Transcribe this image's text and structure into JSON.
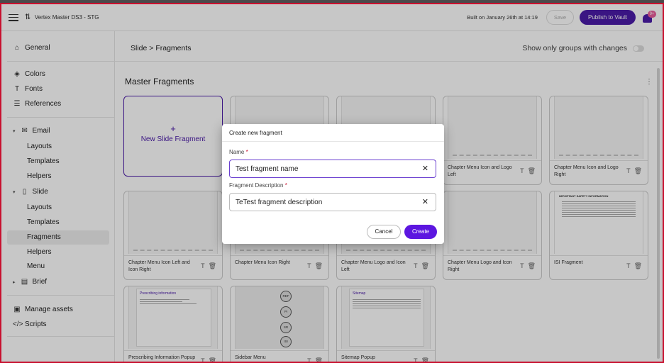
{
  "topbar": {
    "app_title": "Vertex Master DS3 - STG",
    "built_text": "Built on January 26th at 14:19",
    "save_label": "Save",
    "publish_label": "Publish to Vault",
    "notification_badge": "9+"
  },
  "sidebar": {
    "general": "General",
    "colors": "Colors",
    "fonts": "Fonts",
    "references": "References",
    "email": "Email",
    "email_items": [
      "Layouts",
      "Templates",
      "Helpers"
    ],
    "slide": "Slide",
    "slide_items": [
      "Layouts",
      "Templates",
      "Fragments",
      "Helpers",
      "Menu"
    ],
    "brief": "Brief",
    "manage_assets": "Manage assets",
    "scripts": "Scripts"
  },
  "main": {
    "breadcrumb": "Slide > Fragments",
    "show_only_label": "Show only groups with changes",
    "section_title": "Master Fragments",
    "new_fragment_label": "New Slide Fragment",
    "cards": [
      {
        "label": "Chapter Menu Icon and Logo Left"
      },
      {
        "label": "Chapter Menu Icon and Logo Right"
      },
      {
        "label": "Chapter Menu Icon Left and Icon Right"
      },
      {
        "label": "Chapter Menu Icon Right"
      },
      {
        "label": "Chapter Menu Logo and Icon Left"
      },
      {
        "label": "Chapter Menu Logo and Icon Right"
      },
      {
        "label": "ISI Fragment"
      },
      {
        "label": "Prescribing Information Popup"
      },
      {
        "label": "Sidebar Menu"
      },
      {
        "label": "Sitemap Popup"
      }
    ],
    "thumb_texts": {
      "isi_title": "IMPORTANT SAFETY INFORMATION",
      "pi_title": "Prescribing information",
      "sitemap_title": "Sitemap",
      "sidebar_buttons": [
        "REF",
        "PI",
        "SR",
        "ISI"
      ]
    }
  },
  "modal": {
    "title": "Create new fragment",
    "name_label": "Name",
    "name_value": "Test fragment name",
    "desc_label": "Fragment Description",
    "desc_value": "TeTest fragment description",
    "required_mark": "*",
    "cancel_label": "Cancel",
    "create_label": "Create"
  }
}
